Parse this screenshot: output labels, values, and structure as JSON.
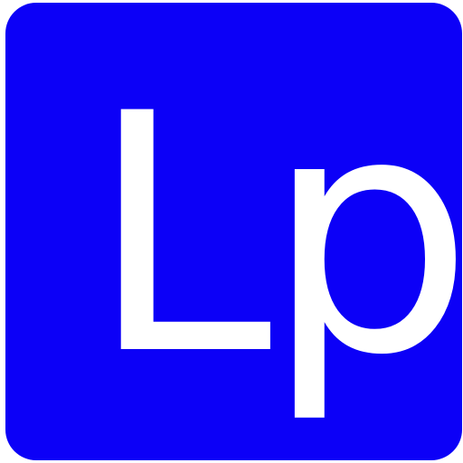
{
  "icon": {
    "text": "Lp",
    "background_color": "#0c00f7",
    "text_color": "#ffffff"
  }
}
